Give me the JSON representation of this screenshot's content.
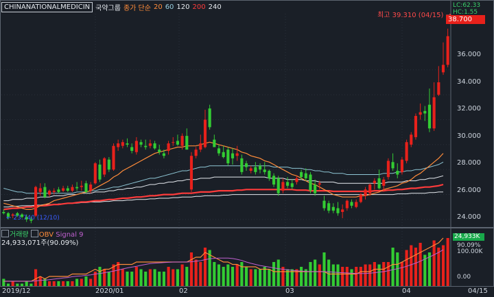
{
  "header": {
    "symbol": "CHINANATIONALMEDICIN",
    "group_name": "국약그룹",
    "ma_label": "종가 단순",
    "periods": [
      "20",
      "60",
      "120",
      "200",
      "240"
    ]
  },
  "annotations": {
    "high": "최고 39.310 (04/15) →",
    "low": "23.740 (12/10)",
    "lc": "LC:62.33",
    "hc": "HC:1.55"
  },
  "current_price": "38.700",
  "y_axis": [
    "36.000",
    "34.000",
    "32.000",
    "30.000",
    "28.000",
    "26.000",
    "24.000"
  ],
  "volume": {
    "labels": [
      "거래량",
      "OBV",
      "Signal 9"
    ],
    "value": "24,933,071주(90.09%)",
    "tag": "24,933K",
    "ticks": [
      "90.09%",
      "100.00K",
      "0.00"
    ]
  },
  "x_axis": [
    "2019/12",
    "2020/01",
    "02",
    "03",
    "04",
    "04/15"
  ],
  "colors": {
    "up": "#e8211b",
    "down": "#33cc33",
    "ma20": "#ff8c3a",
    "ma60": "#8fc7d6",
    "ma120": "#e6eaef",
    "ma200": "#ff3b3b",
    "ma240": "#e6eaef"
  },
  "chart_data": {
    "type": "candlestick",
    "ylim": [
      23.5,
      40.5
    ],
    "candles": [
      {
        "o": 24.6,
        "h": 24.8,
        "l": 24.4,
        "c": 24.5
      },
      {
        "o": 24.5,
        "h": 24.6,
        "l": 24.0,
        "c": 24.2
      },
      {
        "o": 24.3,
        "h": 24.5,
        "l": 24.1,
        "c": 24.4
      },
      {
        "o": 24.5,
        "h": 24.6,
        "l": 24.2,
        "c": 24.3
      },
      {
        "o": 24.4,
        "h": 24.5,
        "l": 24.1,
        "c": 24.2
      },
      {
        "o": 24.2,
        "h": 24.4,
        "l": 23.8,
        "c": 24.0
      },
      {
        "o": 24.0,
        "h": 24.2,
        "l": 23.7,
        "c": 23.9
      },
      {
        "o": 24.3,
        "h": 26.7,
        "l": 24.2,
        "c": 26.6
      },
      {
        "o": 26.2,
        "h": 26.9,
        "l": 25.9,
        "c": 26.5
      },
      {
        "o": 26.6,
        "h": 26.9,
        "l": 25.7,
        "c": 25.8
      },
      {
        "o": 26.0,
        "h": 26.4,
        "l": 25.8,
        "c": 26.3
      },
      {
        "o": 26.2,
        "h": 26.5,
        "l": 26.0,
        "c": 26.3
      },
      {
        "o": 26.4,
        "h": 26.6,
        "l": 26.1,
        "c": 26.2
      },
      {
        "o": 26.3,
        "h": 26.7,
        "l": 26.2,
        "c": 26.5
      },
      {
        "o": 26.5,
        "h": 26.7,
        "l": 26.2,
        "c": 26.3
      },
      {
        "o": 26.3,
        "h": 26.8,
        "l": 26.2,
        "c": 26.6
      },
      {
        "o": 26.6,
        "h": 27.0,
        "l": 26.3,
        "c": 26.5
      },
      {
        "o": 26.6,
        "h": 27.1,
        "l": 26.3,
        "c": 26.7
      },
      {
        "o": 26.9,
        "h": 27.1,
        "l": 26.1,
        "c": 26.2
      },
      {
        "o": 26.3,
        "h": 27.0,
        "l": 26.1,
        "c": 26.8
      },
      {
        "o": 26.9,
        "h": 28.6,
        "l": 26.8,
        "c": 28.5
      },
      {
        "o": 28.4,
        "h": 28.8,
        "l": 27.0,
        "c": 27.2
      },
      {
        "o": 27.6,
        "h": 29.0,
        "l": 27.4,
        "c": 28.9
      },
      {
        "o": 28.8,
        "h": 29.0,
        "l": 27.8,
        "c": 28.0
      },
      {
        "o": 28.0,
        "h": 30.1,
        "l": 27.9,
        "c": 29.9
      },
      {
        "o": 29.8,
        "h": 30.4,
        "l": 29.5,
        "c": 30.1
      },
      {
        "o": 29.9,
        "h": 30.4,
        "l": 29.7,
        "c": 30.2
      },
      {
        "o": 30.1,
        "h": 30.5,
        "l": 29.8,
        "c": 30.0
      },
      {
        "o": 29.8,
        "h": 30.1,
        "l": 29.3,
        "c": 29.5
      },
      {
        "o": 29.4,
        "h": 30.6,
        "l": 29.2,
        "c": 30.3
      },
      {
        "o": 30.2,
        "h": 30.4,
        "l": 29.8,
        "c": 30.0
      },
      {
        "o": 29.9,
        "h": 30.4,
        "l": 29.6,
        "c": 29.8
      },
      {
        "o": 29.9,
        "h": 30.4,
        "l": 29.7,
        "c": 30.1
      },
      {
        "o": 30.1,
        "h": 30.3,
        "l": 29.6,
        "c": 29.7
      },
      {
        "o": 29.6,
        "h": 30.0,
        "l": 29.2,
        "c": 29.4
      },
      {
        "o": 29.3,
        "h": 29.6,
        "l": 28.9,
        "c": 29.1
      },
      {
        "o": 29.5,
        "h": 30.3,
        "l": 29.2,
        "c": 30.1
      },
      {
        "o": 30.2,
        "h": 30.6,
        "l": 29.9,
        "c": 30.2
      },
      {
        "o": 30.3,
        "h": 30.8,
        "l": 29.9,
        "c": 30.0
      },
      {
        "o": 29.9,
        "h": 30.9,
        "l": 29.6,
        "c": 30.7
      },
      {
        "o": 30.7,
        "h": 31.3,
        "l": 29.6,
        "c": 29.6
      },
      {
        "o": 26.4,
        "h": 29.4,
        "l": 26.2,
        "c": 29.1
      },
      {
        "o": 29.1,
        "h": 29.8,
        "l": 28.9,
        "c": 29.6
      },
      {
        "o": 29.6,
        "h": 30.8,
        "l": 29.4,
        "c": 30.1
      },
      {
        "o": 29.8,
        "h": 32.8,
        "l": 29.7,
        "c": 32.0
      },
      {
        "o": 32.9,
        "h": 33.2,
        "l": 31.2,
        "c": 31.4
      },
      {
        "o": 30.4,
        "h": 30.8,
        "l": 29.8,
        "c": 29.8
      },
      {
        "o": 29.7,
        "h": 30.0,
        "l": 29.1,
        "c": 29.3
      },
      {
        "o": 29.4,
        "h": 29.9,
        "l": 28.9,
        "c": 29.0
      },
      {
        "o": 29.6,
        "h": 29.8,
        "l": 28.3,
        "c": 28.5
      },
      {
        "o": 29.3,
        "h": 29.7,
        "l": 28.4,
        "c": 28.9
      },
      {
        "o": 29.1,
        "h": 29.9,
        "l": 28.7,
        "c": 29.3
      },
      {
        "o": 28.9,
        "h": 29.2,
        "l": 27.6,
        "c": 27.8
      },
      {
        "o": 28.5,
        "h": 28.7,
        "l": 27.9,
        "c": 28.2
      },
      {
        "o": 27.9,
        "h": 28.3,
        "l": 27.7,
        "c": 28.1
      },
      {
        "o": 28.2,
        "h": 28.6,
        "l": 27.6,
        "c": 27.8
      },
      {
        "o": 28.3,
        "h": 28.5,
        "l": 27.7,
        "c": 28.0
      },
      {
        "o": 28.0,
        "h": 28.6,
        "l": 27.6,
        "c": 27.8
      },
      {
        "o": 27.9,
        "h": 28.0,
        "l": 27.1,
        "c": 27.3
      },
      {
        "o": 27.5,
        "h": 27.7,
        "l": 26.6,
        "c": 26.8
      },
      {
        "o": 27.3,
        "h": 27.5,
        "l": 25.9,
        "c": 26.1
      },
      {
        "o": 26.3,
        "h": 27.3,
        "l": 26.1,
        "c": 27.0
      },
      {
        "o": 27.0,
        "h": 27.4,
        "l": 26.5,
        "c": 26.7
      },
      {
        "o": 26.9,
        "h": 27.2,
        "l": 26.4,
        "c": 26.6
      },
      {
        "o": 27.0,
        "h": 27.5,
        "l": 26.8,
        "c": 27.3
      },
      {
        "o": 27.8,
        "h": 28.0,
        "l": 27.2,
        "c": 27.4
      },
      {
        "o": 27.7,
        "h": 28.1,
        "l": 27.1,
        "c": 27.3
      },
      {
        "o": 27.6,
        "h": 27.8,
        "l": 26.1,
        "c": 26.3
      },
      {
        "o": 26.8,
        "h": 27.2,
        "l": 25.9,
        "c": 26.1
      },
      {
        "o": 26.8,
        "h": 27.1,
        "l": 26.4,
        "c": 26.9
      },
      {
        "o": 25.5,
        "h": 25.9,
        "l": 24.7,
        "c": 24.9
      },
      {
        "o": 25.3,
        "h": 25.5,
        "l": 24.5,
        "c": 24.7
      },
      {
        "o": 25.0,
        "h": 25.3,
        "l": 24.5,
        "c": 24.7
      },
      {
        "o": 24.9,
        "h": 25.4,
        "l": 24.3,
        "c": 24.5
      },
      {
        "o": 24.6,
        "h": 25.2,
        "l": 24.1,
        "c": 24.8
      },
      {
        "o": 24.9,
        "h": 25.6,
        "l": 24.7,
        "c": 25.5
      },
      {
        "o": 25.4,
        "h": 25.6,
        "l": 24.9,
        "c": 25.1
      },
      {
        "o": 25.0,
        "h": 25.6,
        "l": 24.9,
        "c": 25.4
      },
      {
        "o": 25.4,
        "h": 26.1,
        "l": 25.3,
        "c": 26.0
      },
      {
        "o": 25.9,
        "h": 26.6,
        "l": 25.6,
        "c": 26.4
      },
      {
        "o": 26.1,
        "h": 26.9,
        "l": 25.9,
        "c": 26.8
      },
      {
        "o": 26.9,
        "h": 27.3,
        "l": 26.4,
        "c": 27.1
      },
      {
        "o": 27.3,
        "h": 28.0,
        "l": 26.4,
        "c": 26.5
      },
      {
        "o": 26.7,
        "h": 27.4,
        "l": 26.3,
        "c": 27.2
      },
      {
        "o": 27.4,
        "h": 28.9,
        "l": 27.2,
        "c": 28.7
      },
      {
        "o": 28.6,
        "h": 29.3,
        "l": 27.9,
        "c": 28.1
      },
      {
        "o": 27.9,
        "h": 28.5,
        "l": 27.3,
        "c": 27.6
      },
      {
        "o": 27.8,
        "h": 29.0,
        "l": 27.6,
        "c": 28.8
      },
      {
        "o": 28.7,
        "h": 30.4,
        "l": 28.5,
        "c": 30.2
      },
      {
        "o": 30.0,
        "h": 31.0,
        "l": 29.8,
        "c": 30.8
      },
      {
        "o": 30.6,
        "h": 32.5,
        "l": 30.4,
        "c": 32.3
      },
      {
        "o": 32.4,
        "h": 33.3,
        "l": 32.0,
        "c": 32.6
      },
      {
        "o": 32.7,
        "h": 33.1,
        "l": 31.9,
        "c": 32.5
      },
      {
        "o": 33.2,
        "h": 34.5,
        "l": 31.0,
        "c": 31.3
      },
      {
        "o": 31.3,
        "h": 35.0,
        "l": 31.1,
        "c": 33.8
      },
      {
        "o": 34.0,
        "h": 36.3,
        "l": 33.9,
        "c": 35.0
      },
      {
        "o": 35.8,
        "h": 38.2,
        "l": 35.6,
        "c": 36.4
      },
      {
        "o": 36.4,
        "h": 39.3,
        "l": 36.2,
        "c": 38.7
      }
    ],
    "ma20": [
      25.3,
      25.2,
      25.1,
      25.0,
      24.9,
      24.8,
      24.8,
      24.9,
      25.1,
      25.2,
      25.3,
      25.5,
      25.6,
      25.7,
      25.8,
      25.9,
      26.0,
      26.1,
      26.2,
      26.3,
      26.5,
      26.7,
      26.9,
      27.1,
      27.4,
      27.6,
      27.9,
      28.1,
      28.3,
      28.5,
      28.7,
      28.9,
      29.1,
      29.3,
      29.4,
      29.5,
      29.6,
      29.7,
      29.8,
      29.8,
      29.9,
      29.9,
      29.9,
      30.0,
      30.1,
      30.2,
      30.1,
      30.0,
      29.9,
      29.8,
      29.7,
      29.6,
      29.4,
      29.3,
      29.1,
      29.0,
      28.9,
      28.7,
      28.6,
      28.4,
      28.2,
      28.0,
      27.8,
      27.6,
      27.5,
      27.3,
      27.1,
      26.9,
      26.8,
      26.6,
      26.4,
      26.2,
      26.0,
      25.9,
      25.8,
      25.8,
      25.8,
      25.8,
      25.9,
      25.9,
      26.0,
      26.1,
      26.2,
      26.4,
      26.5,
      26.6,
      26.7,
      26.9,
      27.0,
      27.2,
      27.5,
      27.7,
      28.0,
      28.3,
      28.6,
      28.9,
      29.3
    ],
    "ma60": [
      26.5,
      26.4,
      26.3,
      26.2,
      26.2,
      26.1,
      26.1,
      26.1,
      26.1,
      26.1,
      26.1,
      26.1,
      26.1,
      26.1,
      26.1,
      26.1,
      26.2,
      26.2,
      26.2,
      26.3,
      26.3,
      26.4,
      26.4,
      26.5,
      26.6,
      26.6,
      26.7,
      26.8,
      26.9,
      27.0,
      27.1,
      27.2,
      27.3,
      27.3,
      27.4,
      27.5,
      27.6,
      27.7,
      27.8,
      27.9,
      27.9,
      28.0,
      28.1,
      28.2,
      28.2,
      28.3,
      28.3,
      28.3,
      28.3,
      28.3,
      28.3,
      28.3,
      28.3,
      28.3,
      28.3,
      28.3,
      28.3,
      28.3,
      28.3,
      28.2,
      28.2,
      28.2,
      28.2,
      28.1,
      28.1,
      28.1,
      28.0,
      28.0,
      27.9,
      27.9,
      27.8,
      27.8,
      27.7,
      27.7,
      27.7,
      27.6,
      27.6,
      27.6,
      27.6,
      27.6,
      27.6,
      27.6,
      27.6,
      27.7,
      27.7,
      27.7,
      27.8,
      27.8,
      27.9,
      27.9,
      28.0,
      28.0,
      28.1,
      28.2,
      28.3,
      28.4,
      28.6
    ],
    "ma120": [
      25.5,
      25.5,
      25.6,
      25.6,
      25.6,
      25.7,
      25.7,
      25.7,
      25.8,
      25.8,
      25.8,
      25.9,
      25.9,
      25.9,
      26.0,
      26.0,
      26.0,
      26.1,
      26.1,
      26.1,
      26.2,
      26.2,
      26.2,
      26.3,
      26.3,
      26.4,
      26.4,
      26.5,
      26.5,
      26.6,
      26.6,
      26.7,
      26.8,
      26.8,
      26.9,
      26.9,
      27.0,
      27.0,
      27.1,
      27.1,
      27.2,
      27.2,
      27.2,
      27.3,
      27.3,
      27.3,
      27.4,
      27.4,
      27.4,
      27.4,
      27.4,
      27.4,
      27.4,
      27.4,
      27.4,
      27.4,
      27.4,
      27.4,
      27.3,
      27.3,
      27.3,
      27.3,
      27.2,
      27.2,
      27.2,
      27.2,
      27.1,
      27.1,
      27.1,
      27.0,
      27.0,
      27.0,
      27.0,
      26.9,
      26.9,
      26.9,
      26.9,
      26.9,
      26.9,
      26.9,
      26.9,
      26.9,
      26.9,
      26.9,
      27.0,
      27.0,
      27.0,
      27.0,
      27.1,
      27.1,
      27.1,
      27.2,
      27.2,
      27.3,
      27.3,
      27.4,
      27.5
    ],
    "ma200": [
      24.8,
      24.85,
      24.9,
      24.9,
      24.95,
      25.0,
      25.0,
      25.05,
      25.1,
      25.1,
      25.15,
      25.2,
      25.2,
      25.25,
      25.3,
      25.3,
      25.35,
      25.4,
      25.4,
      25.45,
      25.5,
      25.5,
      25.55,
      25.6,
      25.6,
      25.65,
      25.7,
      25.7,
      25.75,
      25.8,
      25.8,
      25.85,
      25.9,
      25.9,
      25.95,
      26.0,
      26.0,
      26.0,
      26.05,
      26.1,
      26.1,
      26.1,
      26.15,
      26.2,
      26.2,
      26.2,
      26.25,
      26.3,
      26.3,
      26.3,
      26.3,
      26.35,
      26.35,
      26.4,
      26.4,
      26.4,
      26.4,
      26.4,
      26.4,
      26.4,
      26.4,
      26.4,
      26.4,
      26.4,
      26.35,
      26.35,
      26.35,
      26.3,
      26.3,
      26.3,
      26.3,
      26.3,
      26.25,
      26.25,
      26.25,
      26.25,
      26.25,
      26.25,
      26.25,
      26.25,
      26.25,
      26.3,
      26.3,
      26.3,
      26.35,
      26.35,
      26.4,
      26.4,
      26.45,
      26.5,
      26.5,
      26.55,
      26.6,
      26.6,
      26.65,
      26.7,
      26.8
    ],
    "ma240": [
      25.0,
      25.0,
      25.05,
      25.05,
      25.1,
      25.1,
      25.1,
      25.15,
      25.15,
      25.2,
      25.2,
      25.2,
      25.25,
      25.25,
      25.3,
      25.3,
      25.3,
      25.35,
      25.35,
      25.4,
      25.4,
      25.4,
      25.45,
      25.45,
      25.5,
      25.5,
      25.5,
      25.55,
      25.55,
      25.6,
      25.6,
      25.6,
      25.65,
      25.65,
      25.7,
      25.7,
      25.7,
      25.75,
      25.75,
      25.8,
      25.8,
      25.8,
      25.85,
      25.85,
      25.9,
      25.9,
      25.9,
      25.9,
      25.95,
      25.95,
      26.0,
      26.0,
      26.0,
      26.0,
      26.0,
      26.0,
      26.0,
      26.0,
      26.0,
      26.0,
      26.0,
      26.0,
      26.0,
      26.0,
      26.0,
      26.0,
      26.0,
      26.0,
      26.0,
      26.0,
      26.0,
      26.0,
      26.0,
      26.0,
      26.0,
      26.0,
      26.0,
      26.0,
      26.0,
      26.0,
      26.0,
      26.0,
      26.0,
      26.0,
      26.0,
      26.0,
      26.05,
      26.05,
      26.05,
      26.1,
      26.1,
      26.1,
      26.1,
      26.15,
      26.15,
      26.2,
      26.2
    ],
    "volume": [
      0.15,
      0.05,
      0.1,
      0.05,
      0.05,
      0.1,
      0.05,
      0.35,
      0.2,
      0.15,
      0.1,
      0.1,
      0.1,
      0.1,
      0.1,
      0.1,
      0.15,
      0.15,
      0.2,
      0.15,
      0.3,
      0.4,
      0.35,
      0.3,
      0.45,
      0.5,
      0.35,
      0.3,
      0.3,
      0.4,
      0.35,
      0.3,
      0.35,
      0.35,
      0.3,
      0.3,
      0.4,
      0.35,
      0.35,
      0.45,
      0.4,
      0.7,
      0.55,
      0.5,
      0.8,
      0.75,
      0.5,
      0.45,
      0.4,
      0.45,
      0.4,
      0.45,
      0.5,
      0.4,
      0.35,
      0.35,
      0.35,
      0.4,
      0.35,
      0.5,
      0.55,
      0.4,
      0.35,
      0.35,
      0.35,
      0.4,
      0.35,
      0.5,
      0.55,
      0.45,
      0.7,
      0.55,
      0.45,
      0.45,
      0.4,
      0.4,
      0.35,
      0.4,
      0.4,
      0.45,
      0.45,
      0.5,
      0.45,
      0.5,
      0.5,
      0.8,
      0.7,
      0.5,
      0.75,
      0.85,
      0.8,
      0.9,
      0.65,
      0.7,
      0.95,
      0.8,
      0.85,
      1.0
    ],
    "obv": [
      0.1,
      0.1,
      0.1,
      0.1,
      0.1,
      0.1,
      0.1,
      0.15,
      0.2,
      0.15,
      0.2,
      0.2,
      0.2,
      0.2,
      0.2,
      0.25,
      0.25,
      0.25,
      0.25,
      0.3,
      0.35,
      0.3,
      0.35,
      0.35,
      0.4,
      0.45,
      0.45,
      0.45,
      0.45,
      0.5,
      0.5,
      0.5,
      0.5,
      0.5,
      0.5,
      0.5,
      0.5,
      0.5,
      0.5,
      0.5,
      0.5,
      0.55,
      0.6,
      0.6,
      0.7,
      0.65,
      0.6,
      0.55,
      0.5,
      0.5,
      0.45,
      0.45,
      0.4,
      0.4,
      0.4,
      0.4,
      0.35,
      0.35,
      0.35,
      0.3,
      0.3,
      0.3,
      0.3,
      0.3,
      0.3,
      0.3,
      0.3,
      0.3,
      0.3,
      0.3,
      0.3,
      0.25,
      0.25,
      0.25,
      0.25,
      0.25,
      0.25,
      0.25,
      0.3,
      0.3,
      0.3,
      0.35,
      0.35,
      0.35,
      0.4,
      0.45,
      0.45,
      0.5,
      0.55,
      0.6,
      0.65,
      0.7,
      0.75,
      0.8,
      0.85,
      0.9,
      1.0
    ]
  }
}
